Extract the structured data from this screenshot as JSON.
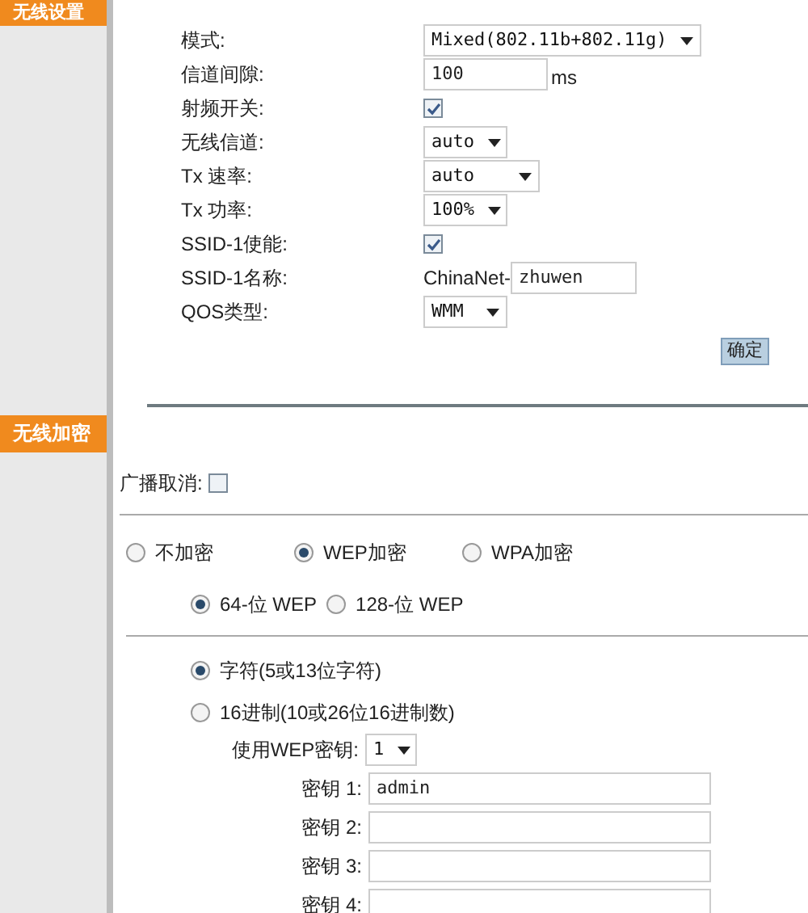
{
  "sidebar": {
    "tabs": [
      {
        "label": "无线设置"
      },
      {
        "label": "无线加密"
      }
    ]
  },
  "wireless_settings": {
    "rows": [
      {
        "kind": "select",
        "label": "模式:",
        "value": "Mixed(802.11b+802.11g)"
      },
      {
        "kind": "input",
        "label": "信道间隙:",
        "value": "100",
        "suffix": "ms"
      },
      {
        "kind": "checkbox",
        "label": "射频开关:",
        "checked": true
      },
      {
        "kind": "select",
        "label": "无线信道:",
        "value": "auto"
      },
      {
        "kind": "select",
        "label": "Tx 速率:",
        "value": "auto"
      },
      {
        "kind": "select",
        "label": "Tx 功率:",
        "value": "100%"
      },
      {
        "kind": "checkbox",
        "label": "SSID-1使能:",
        "checked": true
      },
      {
        "kind": "input",
        "label": "SSID-1名称:",
        "prefix": "ChinaNet-",
        "value": "zhuwen"
      },
      {
        "kind": "select",
        "label": "QOS类型:",
        "value": "WMM"
      }
    ],
    "confirm_button": "确定"
  },
  "wireless_encryption": {
    "broadcast_cancel": {
      "label": "广播取消:",
      "checked": false
    },
    "modes": [
      {
        "label": "不加密",
        "selected": false
      },
      {
        "label": "WEP加密",
        "selected": true
      },
      {
        "label": "WPA加密",
        "selected": false
      }
    ],
    "wep_lengths": [
      {
        "label": "64-位 WEP",
        "selected": true
      },
      {
        "label": "128-位 WEP",
        "selected": false
      }
    ],
    "key_formats": [
      {
        "label": "字符(5或13位字符)",
        "selected": true
      },
      {
        "label": "16进制(10或26位16进制数)",
        "selected": false
      }
    ],
    "use_key": {
      "label": "使用WEP密钥:",
      "value": "1"
    },
    "keys": [
      {
        "label": "密钥 1:",
        "value": "admin"
      },
      {
        "label": "密钥 2:"
      },
      {
        "label": "密钥 3:"
      },
      {
        "label": "密钥 4:"
      }
    ]
  }
}
